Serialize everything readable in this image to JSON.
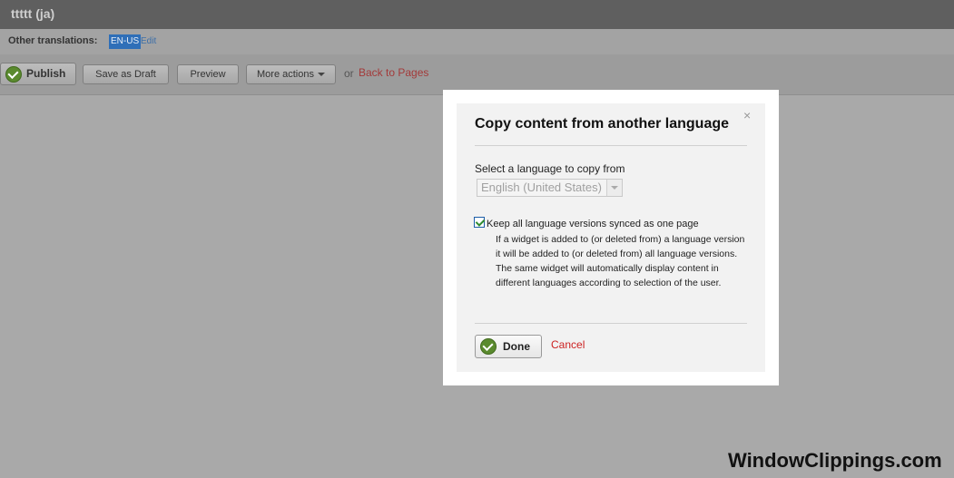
{
  "header": {
    "title": "ttttt (ja)"
  },
  "translations": {
    "label": "Other translations:",
    "tag": "EN-US",
    "edit": "Edit"
  },
  "toolbar": {
    "publish": "Publish",
    "save_draft": "Save as Draft",
    "preview": "Preview",
    "more_actions": "More actions",
    "or": "or",
    "back": "Back to Pages"
  },
  "dialog": {
    "title": "Copy content from another language",
    "close": "×",
    "select_label": "Select a language to copy from",
    "select_value": "English (United States)",
    "checkbox_checked": true,
    "checkbox_label": "Keep all language versions synced as one page",
    "description": "If a widget is added to (or deleted from) a language version it will be added to (or deleted from) all language versions. The same widget will automatically display content in different languages according to selection of the user.",
    "done": "Done",
    "cancel": "Cancel"
  },
  "watermark": "WindowClippings.com",
  "colors": {
    "accent_green": "#5a8a2e",
    "cancel_red": "#cc2222",
    "tag_blue": "#2f6fb8"
  }
}
